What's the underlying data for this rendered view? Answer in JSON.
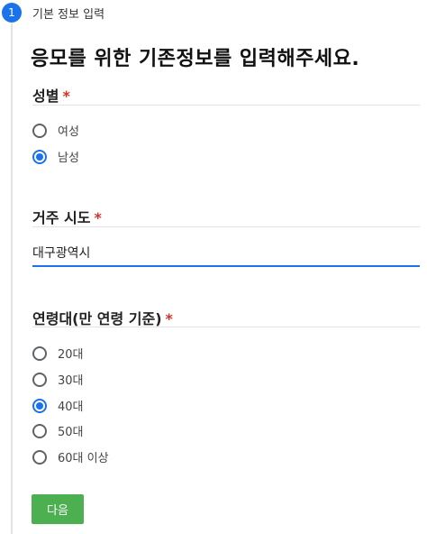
{
  "step": {
    "number": "1",
    "title": "기본 정보 입력"
  },
  "headline": "응모를 위한 기존정보를 입력해주세요.",
  "required_mark": "*",
  "gender": {
    "label": "성별",
    "options": [
      "여성",
      "남성"
    ],
    "selected": "남성"
  },
  "city": {
    "label": "거주 시도",
    "value": "대구광역시"
  },
  "age": {
    "label": "연령대(만 연령 기준)",
    "options": [
      "20대",
      "30대",
      "40대",
      "50대",
      "60대 이상"
    ],
    "selected": "40대"
  },
  "next_button": "다음",
  "colors": {
    "accent": "#1a73e8",
    "button": "#4caf50",
    "required": "#d93025"
  }
}
